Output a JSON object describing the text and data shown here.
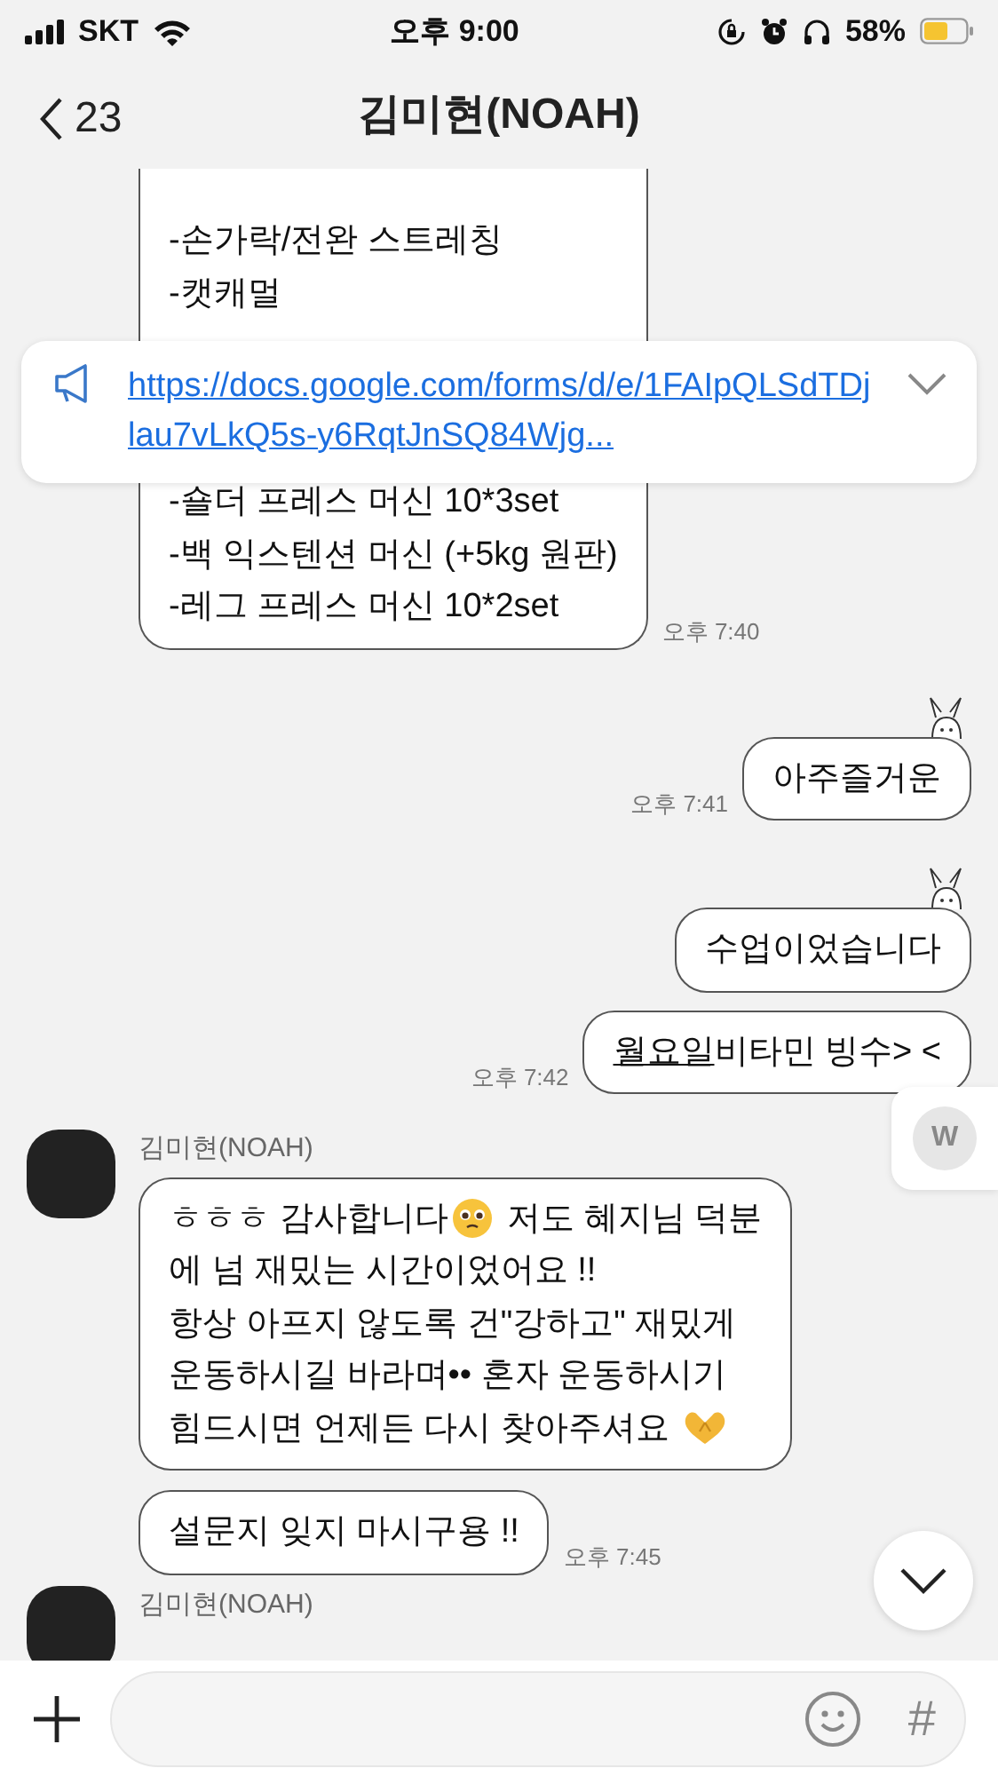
{
  "status_bar": {
    "carrier": "SKT",
    "time": "오후 9:00",
    "battery": "58%"
  },
  "header": {
    "back_count": "23",
    "title": "김미현(NOAH)"
  },
  "notice": {
    "link": "https://docs.google.com/forms/d/e/1FAIpQLSdTDjlau7vLkQ5s-y6RqtJnSQ84Wjg..."
  },
  "messages": [
    {
      "kind": "received",
      "cut_top": true,
      "show_name": false,
      "lines": [
        [
          {
            "kind": "text",
            "text": "-손가락/전완 스트레칭"
          }
        ],
        [
          {
            "kind": "text",
            "text": "-캣캐멀"
          }
        ],
        [
          {
            "kind": "hidden"
          }
        ],
        [
          {
            "kind": "text",
            "text": "-숄더 프레스 머신 10*3set"
          }
        ],
        [
          {
            "kind": "text",
            "text": "-백 익스텐션 머신 (+5kg 원판)"
          }
        ],
        [
          {
            "kind": "text",
            "text": "-레그 프레스 머신 10*2set"
          }
        ]
      ],
      "time": "오후 7:40"
    },
    {
      "kind": "sent",
      "sticker": true,
      "lines": [
        [
          {
            "kind": "text",
            "text": "아주즐거운"
          }
        ]
      ],
      "time": "오후 7:41"
    },
    {
      "kind": "sent",
      "sticker": true,
      "lines": [
        [
          {
            "kind": "text",
            "text": "수업이었습니다"
          }
        ]
      ]
    },
    {
      "kind": "sent",
      "sticker": false,
      "lines": [
        [
          {
            "kind": "text",
            "text": "월요일",
            "underlined": true
          },
          {
            "kind": "text",
            "text": "비타민 빙수> <"
          }
        ]
      ],
      "time": "오후 7:42"
    },
    {
      "kind": "received",
      "show_name": true,
      "sender": "김미현(NOAH)",
      "lines": [
        [
          {
            "kind": "text",
            "text": "ㅎㅎㅎ 감사합니다"
          },
          {
            "kind": "tearful-emoji"
          },
          {
            "kind": "text",
            "text": " 저도 혜지님 덕분"
          }
        ],
        [
          {
            "kind": "text",
            "text": "에 넘 재밌는 시간이었어요 !!"
          }
        ],
        [
          {
            "kind": "text",
            "text": "항상 아프지 않도록 건\"강하고\" 재밌게"
          }
        ],
        [
          {
            "kind": "text",
            "text": "운동하시길 바라며•• 혼자 운동하시기"
          }
        ],
        [
          {
            "kind": "text",
            "text": "힘드시면 언제든 다시 찾아주셔요 "
          },
          {
            "kind": "heart-hands-emoji"
          }
        ]
      ]
    },
    {
      "kind": "received",
      "show_name": false,
      "lines": [
        [
          {
            "kind": "text",
            "text": "설문지 잊지 마시구용 !!"
          }
        ]
      ],
      "time": "오후 7:45"
    },
    {
      "kind": "received",
      "show_name": true,
      "sender": "김미현(NOAH)"
    }
  ],
  "floating_button": {
    "label": "W"
  },
  "input_bar": {
    "hash": "#"
  }
}
